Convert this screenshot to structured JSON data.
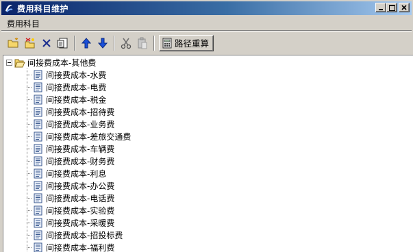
{
  "window": {
    "title": "费用科目维护",
    "controls": [
      "minimize-icon",
      "maximize-icon",
      "close-icon"
    ]
  },
  "menu": {
    "items": [
      {
        "label": "费用科目"
      }
    ]
  },
  "toolbar": {
    "buttons": [
      {
        "icon": "new-folder-icon"
      },
      {
        "icon": "add-item-icon"
      },
      {
        "icon": "delete-x-icon"
      },
      {
        "icon": "edit-doc-icon"
      },
      {
        "icon": "arrow-up-icon"
      },
      {
        "icon": "arrow-down-icon"
      },
      {
        "icon": "cut-scissors-icon"
      },
      {
        "icon": "paste-clipboard-icon"
      }
    ],
    "recalc_label": "路径重算",
    "recalc_icon": "calculator-icon"
  },
  "tree": {
    "root": {
      "label": "间接费成本-其他费",
      "expanded": true
    },
    "children": [
      {
        "label": "间接费成本-水费"
      },
      {
        "label": "间接费成本-电费"
      },
      {
        "label": "间接费成本-税金"
      },
      {
        "label": "间接费成本-招待费"
      },
      {
        "label": "间接费成本-业务费"
      },
      {
        "label": "间接费成本-差旅交通费"
      },
      {
        "label": "间接费成本-车辆费"
      },
      {
        "label": "间接费成本-财务费"
      },
      {
        "label": "间接费成本-利息"
      },
      {
        "label": "间接费成本-办公费"
      },
      {
        "label": "间接费成本-电话费"
      },
      {
        "label": "间接费成本-实验费"
      },
      {
        "label": "间接费成本-采暖费"
      },
      {
        "label": "间接费成本-招投标费"
      },
      {
        "label": "间接费成本-福利费"
      }
    ]
  },
  "colors": {
    "title_gradient_start": "#0a246a",
    "title_gradient_end": "#a6caf0",
    "face": "#d4d0c8",
    "arrow_blue": "#1a4fd8"
  }
}
